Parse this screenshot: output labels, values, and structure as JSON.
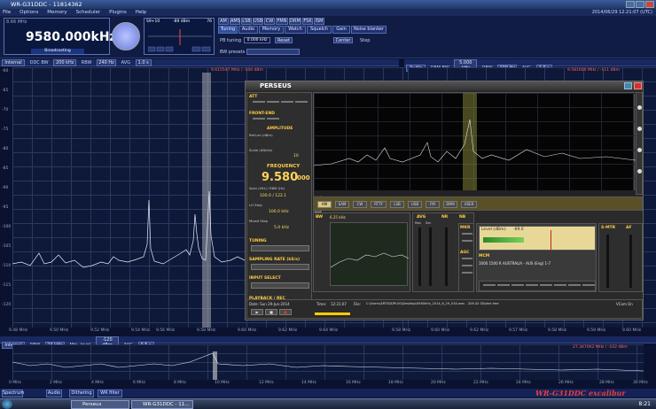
{
  "window": {
    "title": "WR-G31DDC - 11814362"
  },
  "menu": [
    "File",
    "Options",
    "Memory",
    "Scheduler",
    "Plugins",
    "Help"
  ],
  "datetime": "2014/06/29 12:21:07 (UTC)",
  "tuner": {
    "frequency": "9580.000kHz",
    "band": "8.66 MHz",
    "mode_label": "Broadcasting",
    "signal": "-89 dBm",
    "s_meter": "S9+10",
    "pct": "76"
  },
  "mode_buttons": [
    "AM",
    "AMS",
    "LSB",
    "USB",
    "CW",
    "FMN",
    "DRM",
    "FSK",
    "ISM"
  ],
  "tabs": [
    "Tuning",
    "Audio",
    "Memory",
    "Watch",
    "Squelch",
    "Gain",
    "Noise blanker"
  ],
  "pb_tuning": "PB tuning",
  "pb_value": "0.000 kHz",
  "reset": "Reset",
  "center": "Center",
  "step": "Step",
  "bw_presets": "BW presets",
  "left_panel": {
    "title": "Internal",
    "ddc_bw_label": "DDC BW",
    "ddc_bw": "200 kHz",
    "rbw_label": "RBW",
    "rbw": "240 Hz",
    "avg_label": "AVG",
    "avg": "1.0 s",
    "marker": "9.615547 MHz / -100 dBm",
    "y": [
      "-60",
      "-65",
      "-70",
      "-75",
      "-80",
      "-85",
      "-90",
      "-95",
      "-100",
      "-105",
      "-110",
      "-115",
      "-120"
    ],
    "x": [
      "9.48 MHz",
      "9.50 MHz",
      "9.52 MHz",
      "9.54 MHz",
      "9.56 MHz",
      "9.58 MHz",
      "9.60 MHz",
      "9.62 MHz",
      "9.64 MHz"
    ]
  },
  "right_panel": {
    "title": "Audio",
    "dem_bw_label": "DEM BW",
    "dem_bw": "5.000 kHz",
    "rbw_label": "RBW",
    "rbw": "200 Hz",
    "avg_label": "AVG",
    "avg": "2.0 s",
    "marker": "9.581600 MHz / -111 dBm",
    "x": [
      "9.58 MHz",
      "9.60 MHz",
      "9.62 MHz",
      "9.57 MHz",
      "9.58 MHz",
      "9.59 MHz",
      "9.60 MHz"
    ]
  },
  "perseus": {
    "title": "PERSEUS",
    "att": "ATT",
    "front_end": "FRONT-END",
    "amplitude": "AMPLITUDE",
    "ref_lev": "Ref.Lev (dBm)",
    "scale": "Scale (dB/div)",
    "scale_val": "10",
    "frequency_label": "FREQUENCY",
    "frequency": "9.580",
    "frequency_sub": "000",
    "span_label": "Span (kHz) / RBW (Hz)",
    "span": "100.0 / 122.1",
    "lo_step": "LO Step",
    "lo_step_val": "100.0 kHz",
    "mixed_step": "Mixed Step",
    "mixed_val": "5.0 kHz",
    "tuning": "TUNING",
    "sampling_rate": "SAMPLING RATE (kS/s)",
    "input_select": "INPUT SELECT",
    "playback": "PLAYBACK / REC",
    "modes": [
      "AM",
      "SAM",
      "CW",
      "RTTY",
      "LSB",
      "USB",
      "FM",
      "DRM",
      "USER"
    ],
    "bw": "BW",
    "bw_val": "6.25 kHz",
    "avg": "AVG",
    "nr": "NR",
    "nb": "NB",
    "mkr": "MKR",
    "agc": "AGC",
    "smtr": "S-MTR",
    "af": "AF",
    "mon": "Mon",
    "sec": "Sec",
    "level_label": "Level (dBm):",
    "level_val": "-69.0",
    "mcm": "MCM",
    "mcm_line": "1000 1500 R AUSTRALIA - AUS (Eng)  1-7",
    "date": "Date: Sun 29-Jun-2014",
    "time_label": "Time:",
    "time": "12:21:07",
    "file_label": "File:",
    "file": "C:\\Users\\ARTSDDPL00\\Desktop\\9580kHz_2014_6_29_034.wav - 326.42 GBytes free",
    "vcom": "VCom On"
  },
  "bottom": {
    "title": "Internal",
    "rbw_label": "RBW",
    "rbw": "24 kHz",
    "min_level_label": "Min. level",
    "min_level": "-120 dBm",
    "avg_label": "AVG",
    "avg": "0.5 s",
    "marker": "27.347062 MHz / -102 dBm",
    "x": [
      "0 MHz",
      "2 MHz",
      "4 MHz",
      "6 MHz",
      "8 MHz",
      "10 MHz",
      "12 MHz",
      "14 MHz",
      "16 MHz",
      "18 MHz",
      "20 MHz",
      "22 MHz",
      "24 MHz",
      "26 MHz",
      "28 MHz",
      "30 MHz"
    ],
    "tabs": [
      "Spectrum",
      "Audio",
      "Dithering",
      "WR filter"
    ],
    "brand": "WR-G31DDC excalibur"
  },
  "taskbar": {
    "items": [
      "Perseus",
      "WR-G31DDC - 11..."
    ],
    "clock": "8:21"
  }
}
